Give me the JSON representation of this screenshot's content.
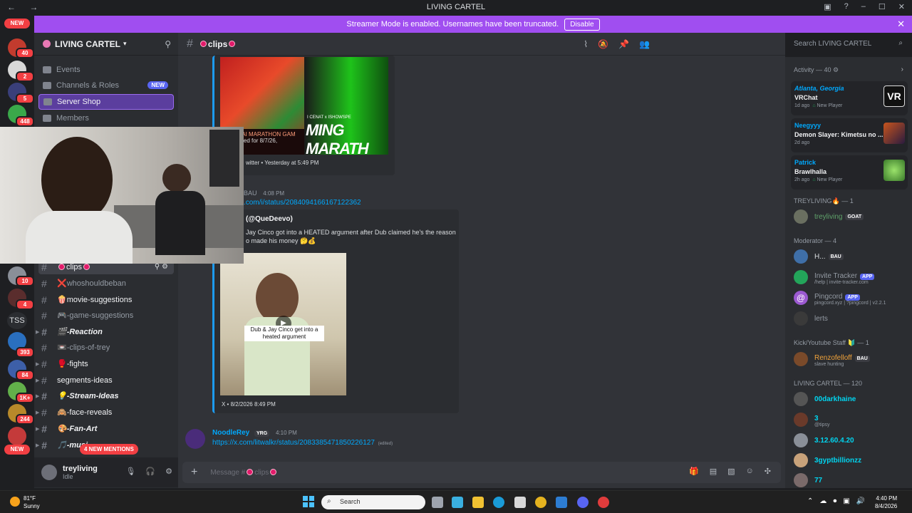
{
  "window": {
    "title": "LIVING CARTEL",
    "nav": "←  →"
  },
  "banner": {
    "text": "Streamer Mode is enabled. Usernames have been truncated.",
    "button": "Disable"
  },
  "guild_bar": {
    "new_top": "NEW",
    "badges": [
      "40",
      "2",
      "5",
      "448",
      "10",
      "4",
      "393",
      "84",
      "1K+",
      "244"
    ],
    "tss": "TSS",
    "new_bottom": "NEW"
  },
  "server": {
    "name": "LIVING CARTEL"
  },
  "server_menu": {
    "events": "Events",
    "channels_roles": "Channels & Roles",
    "new_tag": "NEW",
    "server_shop": "Server Shop",
    "members": "Members"
  },
  "channels": [
    {
      "name": "clips",
      "state": "selected"
    },
    {
      "name": "whoshouldbeban",
      "state": "muted",
      "emoji": "❌"
    },
    {
      "name": "movie-suggestions",
      "state": "bright",
      "emoji": "🍿"
    },
    {
      "name": "-game-suggestions",
      "state": "muted",
      "emoji": "🎮"
    },
    {
      "name": "-Reaction",
      "state": "italic",
      "emoji": "🎬"
    },
    {
      "name": "-clips-of-trey",
      "state": "muted",
      "emoji": "📼"
    },
    {
      "name": "-fights",
      "state": "bright",
      "emoji": "🥊"
    },
    {
      "name": "segments-ideas",
      "state": "bright",
      "emoji": ""
    },
    {
      "name": "-Stream-Ideas",
      "state": "italic",
      "emoji": "💡"
    },
    {
      "name": "-face-reveals",
      "state": "bright",
      "emoji": "🙈"
    },
    {
      "name": "-Fan-Art",
      "state": "italic",
      "emoji": "🎨"
    },
    {
      "name": "-musi",
      "state": "italic",
      "emoji": "🎵"
    }
  ],
  "mentions_pill": "4 NEW MENTIONS",
  "user": {
    "name": "treyliving",
    "status": "Idle"
  },
  "chat": {
    "channel": "clips",
    "embed1": {
      "title_left": "ED X KAI MARATHON GAM",
      "sub_left": "Scheduled for 8/7/26,",
      "title_right": "MING MARATH",
      "caption": "I CENAT x ISHOWSPE",
      "footer": "witter • Yesterday at 5:49 PM"
    },
    "msg2": {
      "author": "BAU",
      "time": "4:08 PM",
      "link": ".com/i/status/2084094166167122362"
    },
    "embed2": {
      "author": "(@QueDeevo)",
      "line1": "Jay Cinco got into a HEATED argument after Dub claimed he's the reason",
      "line2": "o made his money 🤔💰",
      "video_caption": "Dub & Jay Cinco get into a heated argument",
      "footer": "X • 8/2/2026 8:49 PM"
    },
    "msg3": {
      "author": "NoodleRey",
      "tag": "YRG",
      "time": "4:10 PM",
      "link": "https://x.com/litwalkr/status/2083385471850226127",
      "edited": "(edited)"
    },
    "input_placeholder": "Message #"
  },
  "search": {
    "placeholder": "Search LIVING CARTEL"
  },
  "members": {
    "activity_header": "Activity — 40",
    "activities": [
      {
        "name": "Atlanta, Georgia",
        "game": "VRChat",
        "time": "1d ago",
        "extra": "New Player",
        "color": "#00a8fc"
      },
      {
        "name": "Neegyyy",
        "game": "Demon Slayer: Kimetsu no ...",
        "time": "2d ago",
        "extra": "",
        "color": "#00a8fc"
      },
      {
        "name": "Patrick",
        "game": "Brawlhalla",
        "time": "2h ago",
        "extra": "New Player",
        "color": "#00a8fc"
      }
    ],
    "groups": [
      {
        "header": "TREYLIVING🔥 — 1",
        "members": [
          {
            "name": "treyliving",
            "tag": "GOAT",
            "sub": "",
            "color": "#5a7a5c"
          }
        ]
      },
      {
        "header": "Moderator — 4",
        "members": [
          {
            "name": "H...",
            "tag": "BAU",
            "sub": "",
            "color": "#dbdee1"
          },
          {
            "name": "Invite Tracker",
            "tag": "APP",
            "sub": "/help | invite-tracker.com",
            "color": "#949ba4"
          },
          {
            "name": "Pingcord",
            "tag": "APP",
            "sub": "pingcord.xyz | ?pingcord | v2.2.1",
            "color": "#949ba4"
          },
          {
            "name": "lerts",
            "tag": "",
            "sub": "",
            "color": "#949ba4"
          }
        ]
      },
      {
        "header": "Kick/Youtube Staff 🔰 — 1",
        "members": [
          {
            "name": "Renzofelloff",
            "tag": "BAU",
            "sub": "slave hunting",
            "color": "#f0a23a"
          }
        ]
      },
      {
        "header": "LIVING CARTEL — 120",
        "members": [
          {
            "name": "00darkhaine",
            "tag": "",
            "sub": "",
            "color": "#00d5f0"
          },
          {
            "name": "3",
            "tag": "",
            "sub": "@tipsy",
            "color": "#00d5f0"
          },
          {
            "name": "3.12.60.4.20",
            "tag": "",
            "sub": "",
            "color": "#00d5f0"
          },
          {
            "name": "3gyptbillionzz",
            "tag": "",
            "sub": "",
            "color": "#00d5f0"
          },
          {
            "name": "77",
            "tag": "",
            "sub": "",
            "color": "#00d5f0"
          }
        ]
      }
    ]
  },
  "taskbar": {
    "weather_temp": "81°F",
    "weather_text": "Sunny",
    "search": "Search",
    "time": "4:40 PM",
    "date": "8/4/2026"
  }
}
